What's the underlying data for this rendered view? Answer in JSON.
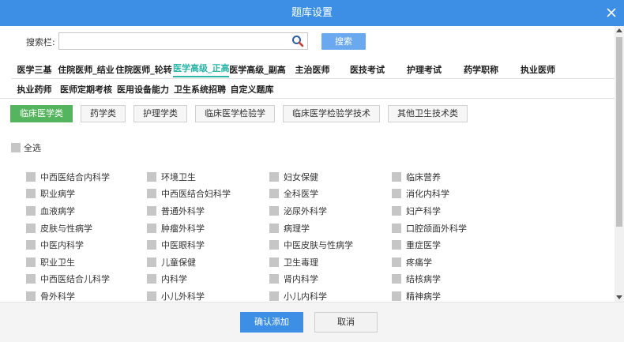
{
  "dialog": {
    "title": "题库设置",
    "close_icon": "close-icon",
    "accent_color": "#3d8fe6"
  },
  "search": {
    "label": "搜索栏:",
    "value": "",
    "placeholder": "",
    "icon": "search-icon",
    "button_label": "搜索"
  },
  "tabs_row1": [
    {
      "label": "医学三基",
      "active": false
    },
    {
      "label": "住院医师_结业",
      "active": false
    },
    {
      "label": "住院医师_轮转",
      "active": false
    },
    {
      "label": "医学高级_正高",
      "active": true
    },
    {
      "label": "医学高级_副高",
      "active": false
    },
    {
      "label": "主治医师",
      "active": false
    },
    {
      "label": "医技考试",
      "active": false
    },
    {
      "label": "护理考试",
      "active": false
    },
    {
      "label": "药学职称",
      "active": false
    },
    {
      "label": "执业医师",
      "active": false
    }
  ],
  "tabs_row2": [
    {
      "label": "执业药师"
    },
    {
      "label": "医师定期考核"
    },
    {
      "label": "医用设备能力"
    },
    {
      "label": "卫生系统招聘"
    },
    {
      "label": "自定义题库"
    }
  ],
  "categories": [
    {
      "label": "临床医学类",
      "active": true
    },
    {
      "label": "药学类",
      "active": false
    },
    {
      "label": "护理学类",
      "active": false
    },
    {
      "label": "临床医学检验学",
      "active": false
    },
    {
      "label": "临床医学检验学技术",
      "active": false
    },
    {
      "label": "其他卫生技术类",
      "active": false
    }
  ],
  "category_active_color": "#55b55e",
  "select_all_label": "全选",
  "subjects": [
    "中西医结合内科学",
    "环境卫生",
    "妇女保健",
    "临床营养",
    "职业病学",
    "中西医结合妇科学",
    "全科医学",
    "消化内科学",
    "血液病学",
    "普通外科学",
    "泌尿外科学",
    "妇产科学",
    "皮肤与性病学",
    "肿瘤外科学",
    "病理学",
    "口腔颌面外科学",
    "中医内科学",
    "中医眼科学",
    "中医皮肤与性病学",
    "重症医学",
    "职业卫生",
    "儿童保健",
    "卫生毒理",
    "疼痛学",
    "中西医结合儿科学",
    "内科学",
    "肾内科学",
    "结核病学",
    "骨外科学",
    "小儿外科学",
    "小儿内科学",
    "精神病学"
  ],
  "footer": {
    "confirm_label": "确认添加",
    "cancel_label": "取消"
  }
}
